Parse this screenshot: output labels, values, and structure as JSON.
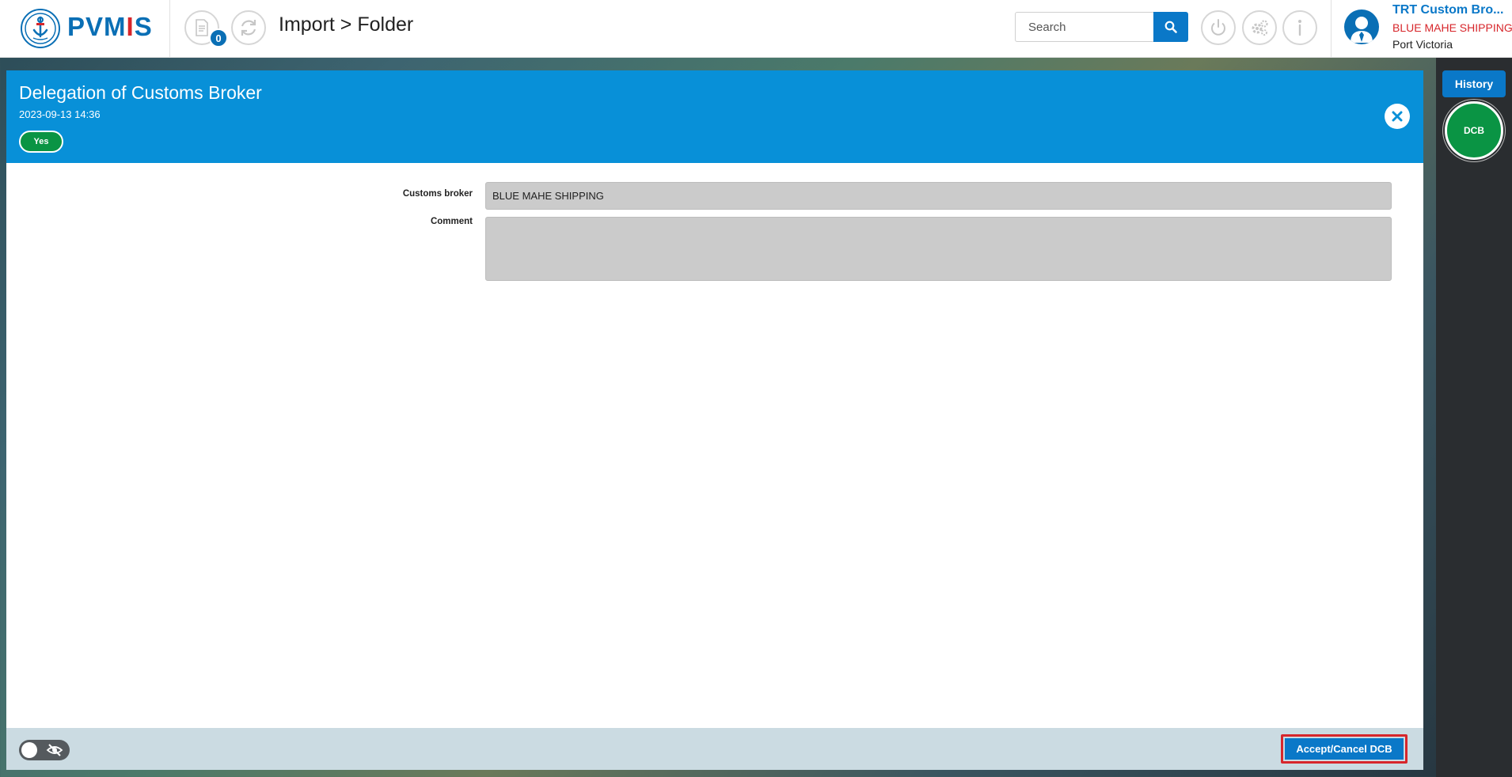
{
  "colors": {
    "brand_blue": "#0a78c8",
    "header_blue": "#0890d8",
    "accent_red": "#d7262b",
    "status_green": "#0a9444"
  },
  "app": {
    "logo_text_main": "PVM",
    "logo_text_accent": "I",
    "logo_text_end": "S"
  },
  "toolbar": {
    "documents_icon": "document-icon",
    "documents_badge": "0",
    "refresh_icon": "refresh-icon"
  },
  "breadcrumb": "Import > Folder",
  "search": {
    "placeholder": "Search",
    "button_icon": "search-icon"
  },
  "header_actions": [
    {
      "icon": "power-icon"
    },
    {
      "icon": "settings-icon"
    },
    {
      "icon": "info-icon"
    }
  ],
  "user": {
    "name": "TRT Custom Bro...",
    "company": "BLUE MAHE SHIPPING",
    "port": "Port Victoria"
  },
  "right_rail": {
    "history_label": "History",
    "status_circle_label": "DCB"
  },
  "modal": {
    "title": "Delegation of Customs Broker",
    "date": "2023-09-13 14:36",
    "status_label": "Yes",
    "fields": {
      "customs_broker_label": "Customs broker",
      "customs_broker_value": "BLUE MAHE SHIPPING",
      "comment_label": "Comment",
      "comment_value": ""
    },
    "footer": {
      "action_label": "Accept/Cancel DCB"
    }
  }
}
